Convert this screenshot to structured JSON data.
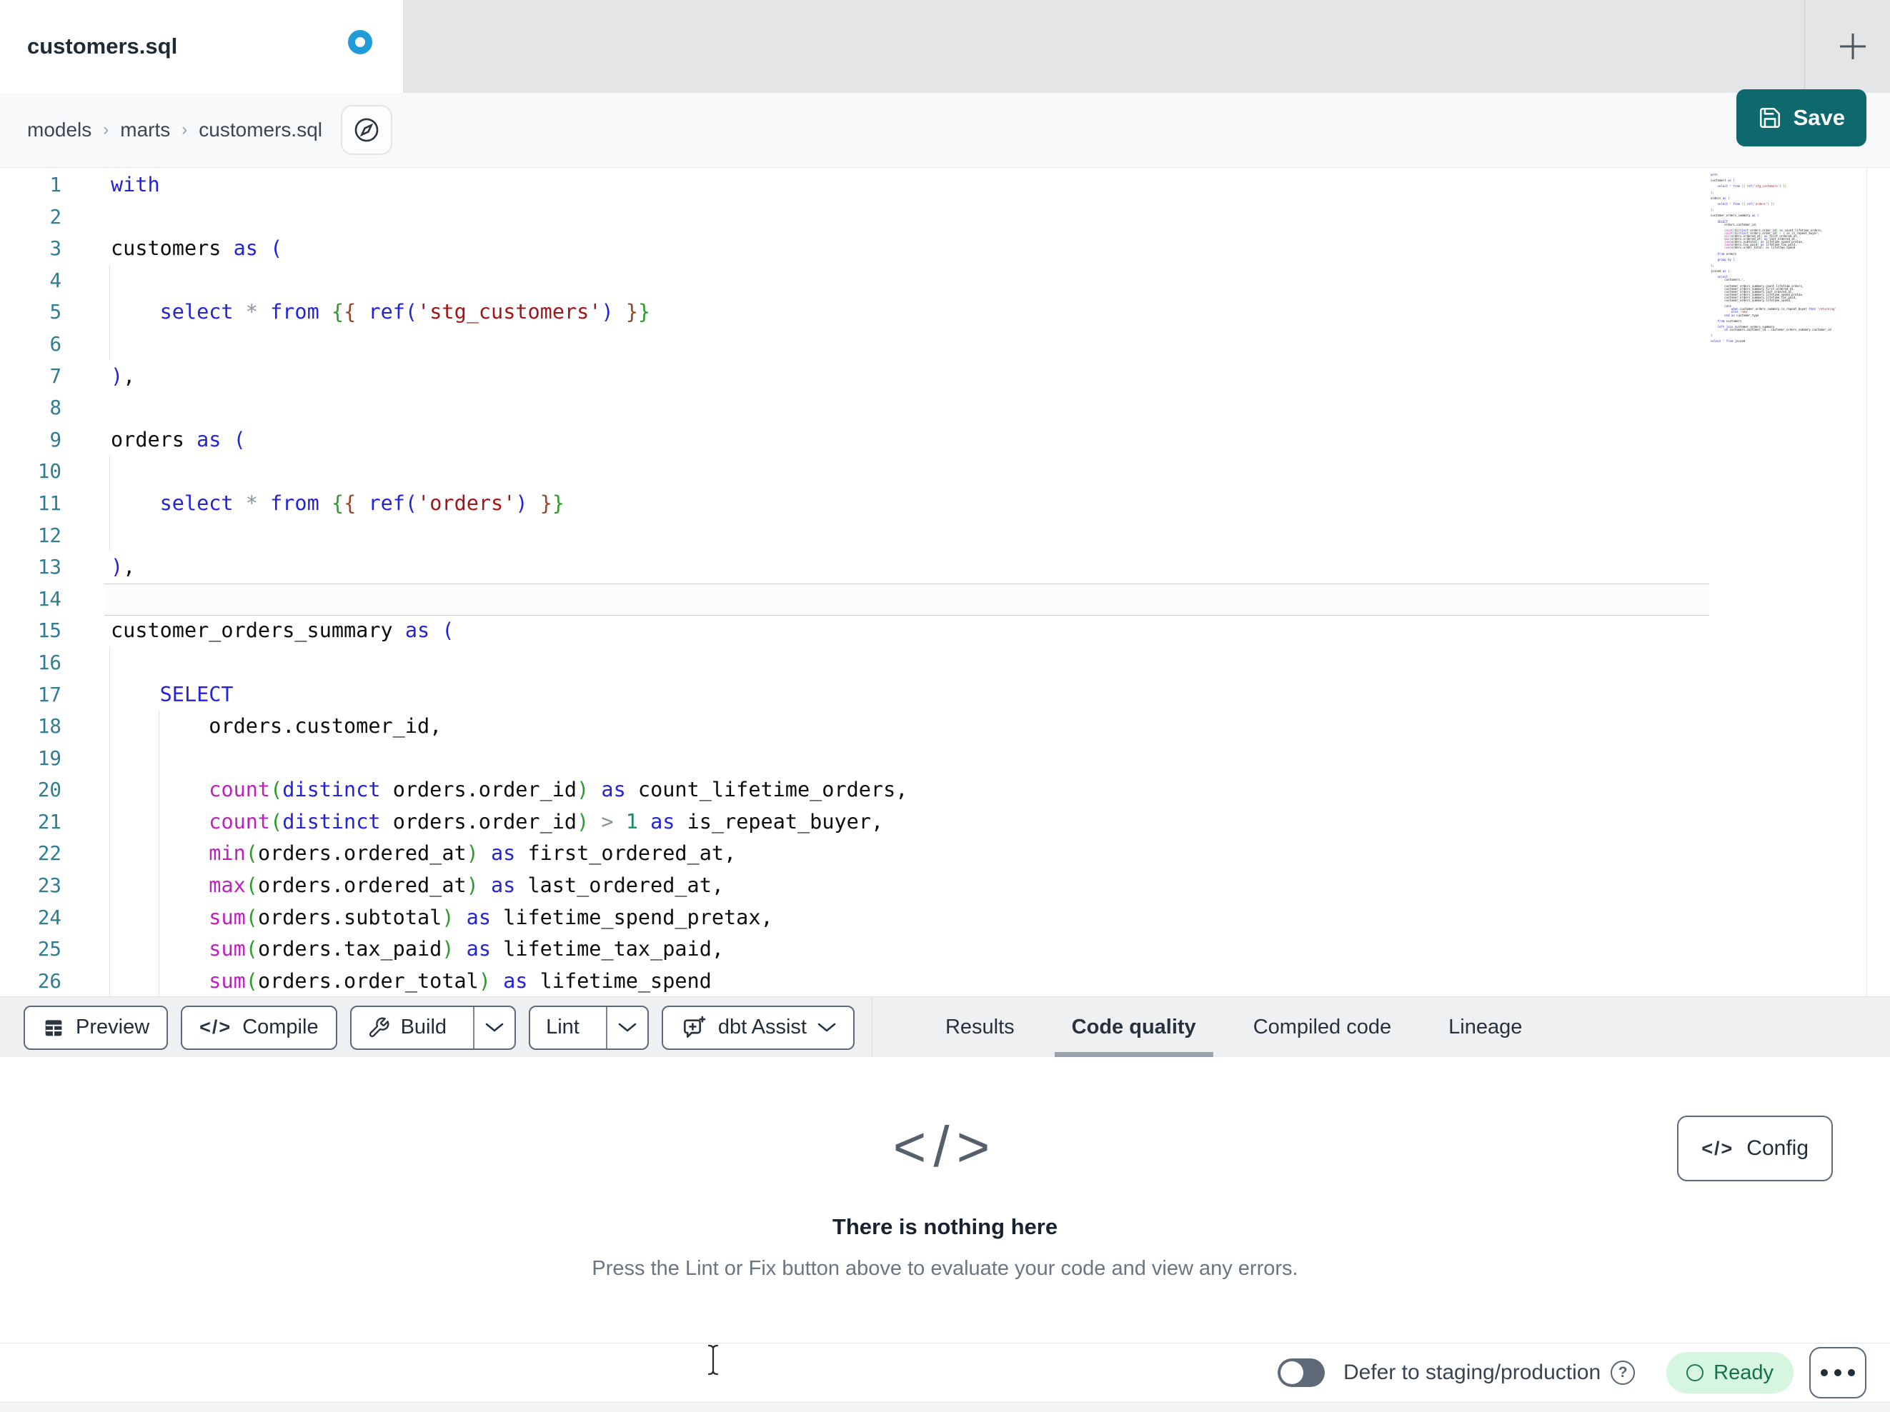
{
  "tabbar": {
    "tab_title": "customers.sql"
  },
  "breadcrumb": {
    "items": [
      "models",
      "marts",
      "customers.sql"
    ],
    "separator": "›"
  },
  "save": {
    "label": "Save"
  },
  "editor": {
    "active_line": 14,
    "visible_line_count": 26,
    "lines": [
      "with",
      "",
      "customers as (",
      "",
      "    select * from {{ ref('stg_customers') }}",
      "",
      "),",
      "",
      "orders as (",
      "",
      "    select * from {{ ref('orders') }}",
      "",
      "),",
      "",
      "customer_orders_summary as (",
      "",
      "    SELECT",
      "        orders.customer_id,",
      "",
      "        count(distinct orders.order_id) as count_lifetime_orders,",
      "        count(distinct orders.order_id) > 1 as is_repeat_buyer,",
      "        min(orders.ordered_at) as first_ordered_at,",
      "        max(orders.ordered_at) as last_ordered_at,",
      "        sum(orders.subtotal) as lifetime_spend_pretax,",
      "        sum(orders.tax_paid) as lifetime_tax_paid,",
      "        sum(orders.order_total) as lifetime_spend",
      "",
      "    from orders",
      "",
      "    group by 1",
      "",
      "),",
      "",
      "joined as (",
      "",
      "    select",
      "        customers.*,",
      "",
      "        customer_orders_summary.count_lifetime_orders,",
      "        customer_orders_summary.first_ordered_at,",
      "        customer_orders_summary.last_ordered_at,",
      "        customer_orders_summary.lifetime_spend_pretax,",
      "        customer_orders_summary.lifetime_tax_paid,",
      "        customer_orders_summary.lifetime_spend,",
      "",
      "        case",
      "            when customer_orders_summary.is_repeat_buyer then 'returning'",
      "            else 'new'",
      "        end as customer_type",
      "",
      "    from customers",
      "",
      "    left join customer_orders_summary",
      "        on customers.customer_id = customer_orders_summary.customer_id",
      "",
      ")",
      "",
      "select * from joined"
    ]
  },
  "toolbar": {
    "preview_label": "Preview",
    "compile_label": "Compile",
    "build_label": "Build",
    "lint_label": "Lint",
    "assist_label": "dbt Assist"
  },
  "panel_tabs": [
    {
      "label": "Results",
      "active": false
    },
    {
      "label": "Code quality",
      "active": true
    },
    {
      "label": "Compiled code",
      "active": false
    },
    {
      "label": "Lineage",
      "active": false
    }
  ],
  "results": {
    "empty_icon": "</>",
    "title": "There is nothing here",
    "subtitle": "Press the Lint or Fix button above to evaluate your code and view any errors.",
    "config_label": "Config",
    "config_icon": "</>"
  },
  "statusbar": {
    "defer_label": "Defer to staging/production",
    "help_glyph": "?",
    "status_label": "Ready"
  },
  "colors": {
    "save_teal": "#0e696e",
    "unsaved_dot_blue": "#219bd8",
    "line_number": "#2f7d93",
    "keyword": "#2323d9",
    "function": "#bf1fbf",
    "string": "#a31515",
    "number": "#178a68",
    "operator": "#8a929b",
    "bracket_levels": [
      "#2323d9",
      "#2e9b2e",
      "#95472b"
    ],
    "ready_bg": "#d7f6e0",
    "ready_text": "#15714b",
    "active_tab_underline": "#9aa2ac"
  }
}
